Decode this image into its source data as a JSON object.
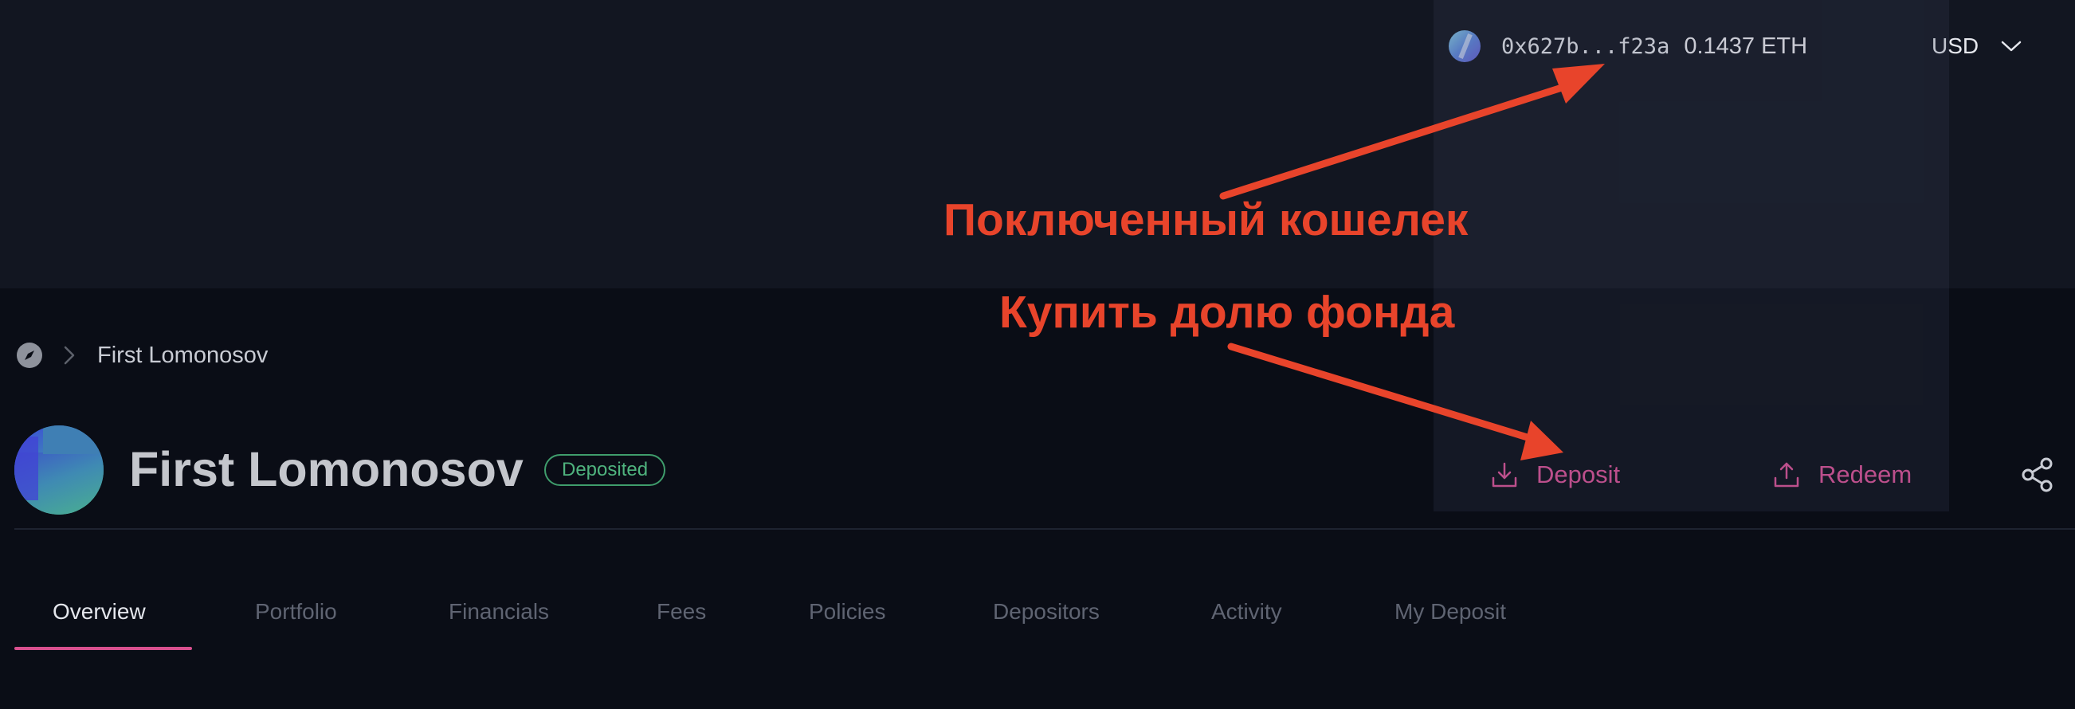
{
  "header": {
    "wallet": {
      "address": "0x627b...f23a",
      "balance": "0.1437 ETH",
      "avatar_icon": "wallet-avatar-icon"
    },
    "currency": {
      "selected": "USD",
      "icon": "chevron-down-icon"
    }
  },
  "breadcrumb": {
    "icon": "compass-icon",
    "separator_icon": "chevron-right-icon",
    "current": "First Lomonosov"
  },
  "fund": {
    "name": "First Lomonosov",
    "status_badge": "Deposited",
    "actions": {
      "deposit": "Deposit",
      "redeem": "Redeem"
    },
    "share_icon": "share-icon"
  },
  "tabs": [
    {
      "label": "Overview",
      "active": true
    },
    {
      "label": "Portfolio",
      "active": false
    },
    {
      "label": "Financials",
      "active": false
    },
    {
      "label": "Fees",
      "active": false
    },
    {
      "label": "Policies",
      "active": false
    },
    {
      "label": "Depositors",
      "active": false
    },
    {
      "label": "Activity",
      "active": false
    },
    {
      "label": "My Deposit",
      "active": false
    }
  ],
  "annotations": {
    "wallet_note": "Поключенный кошелек",
    "buy_note": "Купить долю фонда"
  },
  "colors": {
    "accent_pink": "#e0549a",
    "badge_green": "#4fb37e",
    "annotation_red": "#e8442b",
    "topbar_bg": "#121621",
    "page_bg": "#0a0d16"
  }
}
